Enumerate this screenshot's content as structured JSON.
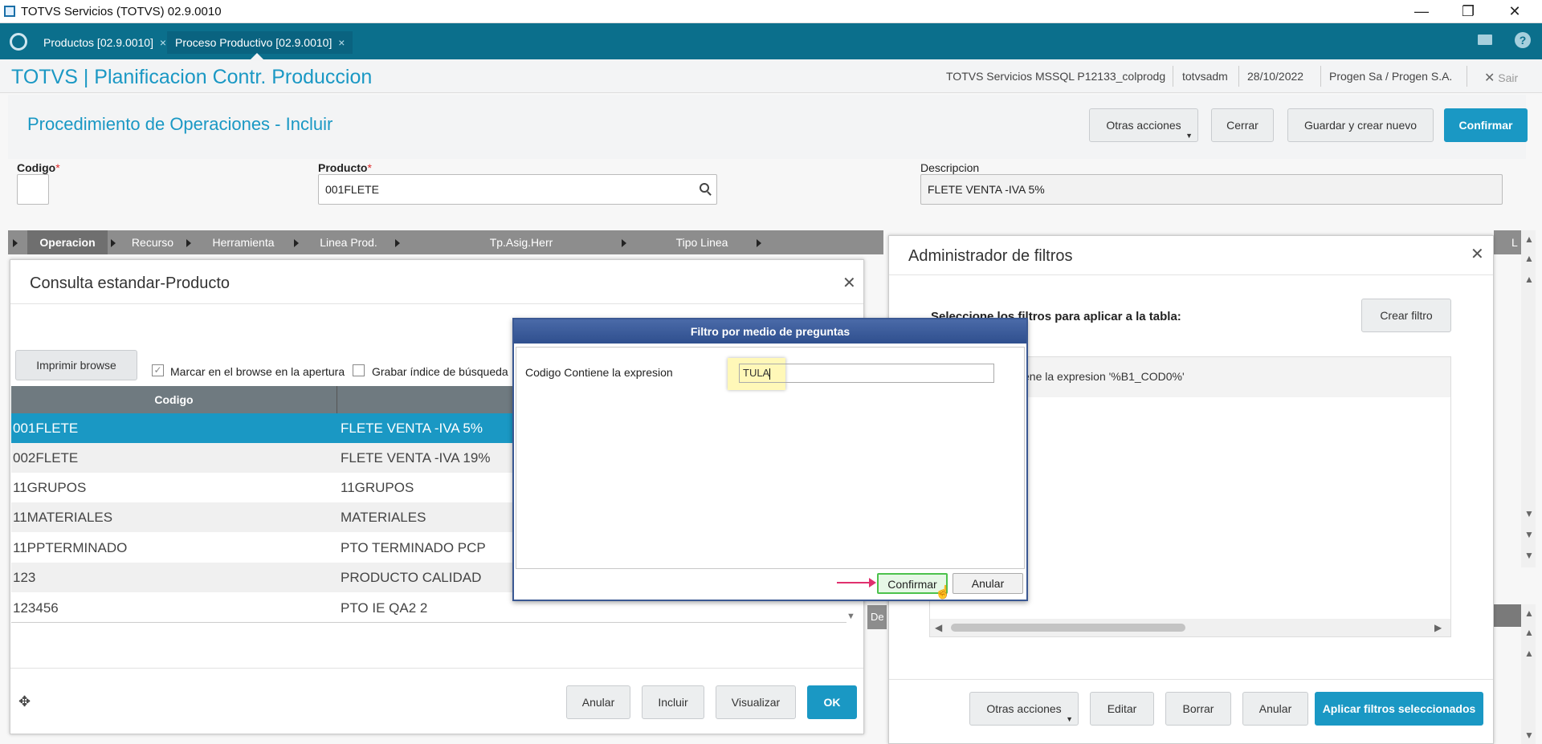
{
  "window": {
    "title": "TOTVS Servicios (TOTVS) 02.9.0010",
    "minimize": "—",
    "restore": "❐",
    "close": "✕"
  },
  "tabs": [
    {
      "label": "Productos [02.9.0010]",
      "close": "×"
    },
    {
      "label": "Proceso Productivo [02.9.0010]",
      "close": "×"
    }
  ],
  "app": {
    "title": "TOTVS | Planificacion Contr. Produccion",
    "server": "TOTVS Servicios MSSQL P12133_colprodg",
    "user": "totvsadm",
    "date": "28/10/2022",
    "company": "Progen Sa / Progen S.A.",
    "exit": "Sair"
  },
  "procedure": {
    "title": "Procedimiento de Operaciones - Incluir",
    "buttons": {
      "otras": "Otras acciones",
      "cerrar": "Cerrar",
      "guardar": "Guardar y crear nuevo",
      "confirmar": "Confirmar"
    },
    "fields": {
      "codigo_label": "Codigo",
      "codigo_value": "",
      "producto_label": "Producto",
      "producto_value": "001FLETE",
      "descripcion_label": "Descripcion",
      "descripcion_value": "FLETE VENTA -IVA 5%",
      "required_mark": "*"
    },
    "grid_columns": [
      "Operacion",
      "Recurso",
      "Herramienta",
      "Linea Prod.",
      "Tp.Asig.Herr",
      "Tipo Linea"
    ],
    "right_col_fragment": "L",
    "de_fragment": "De"
  },
  "consulta": {
    "title": "Consulta estandar-Producto",
    "close": "✕",
    "print_button": "Imprimir browse",
    "check_marcar": "Marcar en el browse en la apertura",
    "check_grabar": "Grabar índice de búsqueda",
    "column_codigo": "Codigo",
    "rows": [
      {
        "codigo": "001FLETE",
        "desc": "FLETE VENTA -IVA 5%"
      },
      {
        "codigo": "002FLETE",
        "desc": "FLETE VENTA -IVA 19%"
      },
      {
        "codigo": "11GRUPOS",
        "desc": "11GRUPOS"
      },
      {
        "codigo": "11MATERIALES",
        "desc": "MATERIALES"
      },
      {
        "codigo": "11PPTERMINADO",
        "desc": "PTO TERMINADO PCP"
      },
      {
        "codigo": "123",
        "desc": "PRODUCTO CALIDAD"
      },
      {
        "codigo": "123456",
        "desc": "PTO IE QA2 2"
      }
    ],
    "selected_row": 0,
    "buttons": {
      "anular": "Anular",
      "incluir": "Incluir",
      "visualizar": "Visualizar",
      "ok": "OK"
    }
  },
  "admin": {
    "title": "Administrador de filtros",
    "close": "✕",
    "select_text": "Seleccione los filtros para aplicar a la tabla:",
    "crear": "Crear filtro",
    "filter_item": "Codigo Contiene la expresion '%B1_COD0%'",
    "filter_item_visible": "ene la expresion '%B1_COD0%'",
    "buttons": {
      "otras": "Otras acciones",
      "editar": "Editar",
      "borrar": "Borrar",
      "anular": "Anular",
      "aplicar": "Aplicar filtros seleccionados"
    }
  },
  "filtro": {
    "title": "Filtro por medio de preguntas",
    "question": "Codigo Contiene la expresion",
    "value": "TULA",
    "confirmar": "Confirmar",
    "anular": "Anular"
  },
  "colors": {
    "tabbar": "#0b6f8c",
    "accent": "#1a98c4",
    "selected_row": "#1a98c4",
    "dialog_title": "#2f4f8e"
  }
}
